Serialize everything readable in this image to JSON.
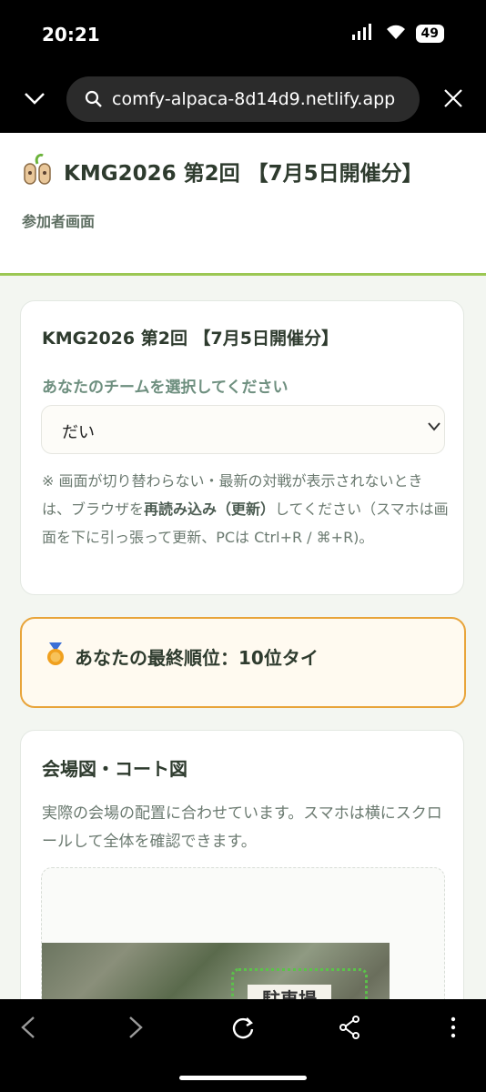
{
  "status_bar": {
    "time": "20:21",
    "battery": "49"
  },
  "browser": {
    "url": "comfy-alpaca-8d14d9.netlify.app",
    "icons": [
      "chevron-down-icon",
      "search-icon",
      "close-icon"
    ]
  },
  "header": {
    "title": "KMG2026 第2回 【7月5日開催分】",
    "subtitle": "参加者画面"
  },
  "team_card": {
    "title": "KMG2026 第2回 【7月5日開催分】",
    "select_label": "あなたのチームを選択してください",
    "selected_team": "だい",
    "note_prefix": "※ 画面が切り替わらない・最新の対戦が表示されないときは、ブラウザを",
    "note_bold": "再読み込み（更新）",
    "note_suffix": "してください（スマホは画面を下に引っ張って更新、PCは Ctrl+R / ⌘+R)。"
  },
  "rank_card": {
    "text": "あなたの最終順位：10位タイ",
    "icon": "medal-icon"
  },
  "map_card": {
    "title": "会場図・コート図",
    "description": "実際の会場の配置に合わせています。スマホは横にスクロールして全体を確認できます。",
    "parking_label": "駐車場"
  },
  "colors": {
    "accent_green": "#9bc753",
    "rank_border": "#e8a43a"
  }
}
